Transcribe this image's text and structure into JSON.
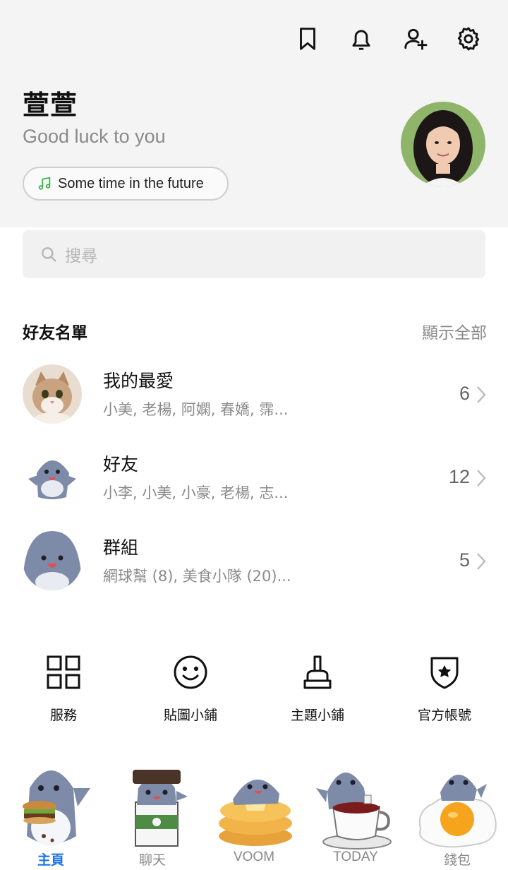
{
  "header": {
    "icons": [
      "bookmark-icon",
      "bell-icon",
      "add-friend-icon",
      "gear-icon"
    ]
  },
  "profile": {
    "name": "萱萱",
    "status": "Good luck to you",
    "music": "Some time in the future"
  },
  "search": {
    "placeholder": "搜尋"
  },
  "friends": {
    "title": "好友名單",
    "show_all": "顯示全部",
    "rows": [
      {
        "title": "我的最愛",
        "subtitle": "小美, 老楊, 阿嫻, 春嬌, 霈...",
        "count": "6"
      },
      {
        "title": "好友",
        "subtitle": "小李, 小美, 小豪, 老楊, 志...",
        "count": "12"
      },
      {
        "title": "群組",
        "subtitle": "網球幫 (8), 美食小隊 (20)...",
        "count": "5"
      }
    ]
  },
  "services": [
    {
      "label": "服務",
      "icon": "grid-icon"
    },
    {
      "label": "貼圖小鋪",
      "icon": "smiley-icon"
    },
    {
      "label": "主題小鋪",
      "icon": "brush-icon"
    },
    {
      "label": "官方帳號",
      "icon": "star-shield-icon"
    }
  ],
  "tabs": [
    {
      "label": "主頁"
    },
    {
      "label": "聊天"
    },
    {
      "label": "VOOM"
    },
    {
      "label": "TODAY"
    },
    {
      "label": "錢包"
    }
  ],
  "colors": {
    "accent": "#1a73e8",
    "music_note": "#3cb44b",
    "shark": "#7d8aa8"
  }
}
